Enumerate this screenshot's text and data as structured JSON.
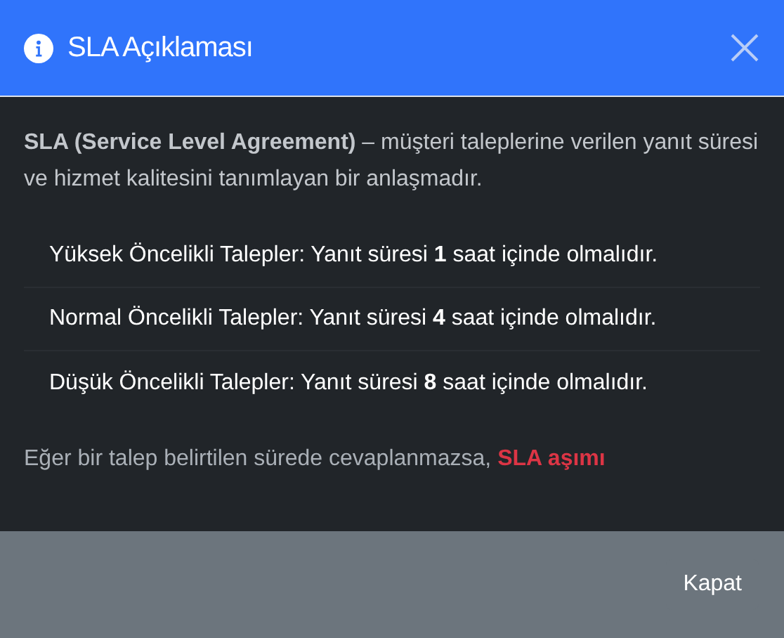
{
  "dialog": {
    "title": "SLA Açıklaması",
    "intro": "**SLA (Service Level Agreement)** – müşteri taleplerine verilen yanıt süresi ve hizmet kalitesini tanımlayan bir anlaşmadır.",
    "rules": [
      "Yüksek Öncelikli Talepler: Yanıt süresi **1** saat içinde olmalıdır.",
      "Normal Öncelikli Talepler: Yanıt süresi **4** saat içinde olmalıdır.",
      "Düşük Öncelikli Talepler: Yanıt süresi **8** saat içinde olmalıdır."
    ],
    "note": {
      "text": "Eğer bir talep belirtilen sürede cevaplanmazsa,",
      "highlight": "SLA aşımı"
    },
    "buttons": [
      "Kapat"
    ]
  }
}
